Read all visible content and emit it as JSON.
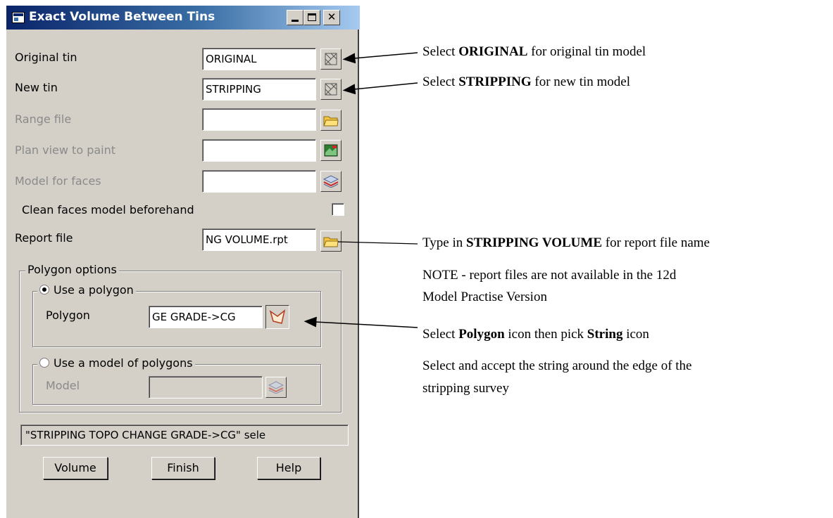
{
  "window": {
    "title": "Exact Volume Between Tins",
    "controls": {
      "minimize": "_",
      "maximize": "□",
      "close": "✕"
    }
  },
  "fields": {
    "original_tin": {
      "label": "Original tin",
      "value": "ORIGINAL",
      "icon": "tin-icon"
    },
    "new_tin": {
      "label": "New tin",
      "value": "STRIPPING",
      "icon": "tin-icon"
    },
    "range_file": {
      "label": "Range file",
      "value": "",
      "icon": "folder-icon"
    },
    "plan_view": {
      "label": "Plan view to paint",
      "value": "",
      "icon": "plan-view-icon"
    },
    "model_faces": {
      "label": "Model for faces",
      "value": "",
      "icon": "model-layers-icon"
    },
    "clean_faces": {
      "label": "Clean faces model beforehand",
      "checked": false
    },
    "report_file": {
      "label": "Report file",
      "value": "NG VOLUME.rpt",
      "icon": "folder-icon"
    }
  },
  "polygon_options": {
    "legend": "Polygon options",
    "use_polygon": {
      "label": "Use a polygon",
      "selected": true,
      "field_label": "Polygon",
      "value": "GE GRADE->CG",
      "icon": "polygon-icon"
    },
    "use_model": {
      "label": "Use a model of polygons",
      "selected": false,
      "field_label": "Model",
      "value": "",
      "icon": "model-layers-icon"
    }
  },
  "status": "\"STRIPPING TOPO CHANGE GRADE->CG\" sele",
  "buttons": {
    "volume": "Volume",
    "finish": "Finish",
    "help": "Help"
  },
  "annotations": {
    "a1": {
      "pre": "Select ",
      "bold": "ORIGINAL",
      "post": " for original tin model"
    },
    "a2": {
      "pre": "Select ",
      "bold": "STRIPPING",
      "post": " for new tin model"
    },
    "a3": {
      "pre": "Type in ",
      "bold": "STRIPPING VOLUME",
      "post": " for report file name"
    },
    "note_line1": "NOTE - report files are not available in the 12d",
    "note_line2": "Model Practise Version",
    "a4": {
      "pre": "Select ",
      "bold1": "Polygon",
      "mid": " icon then pick ",
      "bold2": "String",
      "post": " icon"
    },
    "a5_line1": "Select and accept the string around the edge of the",
    "a5_line2": "stripping survey"
  },
  "colors": {
    "dialog_bg": "#d4d0c8",
    "title_start": "#0a246a",
    "title_end": "#a6caf0"
  }
}
